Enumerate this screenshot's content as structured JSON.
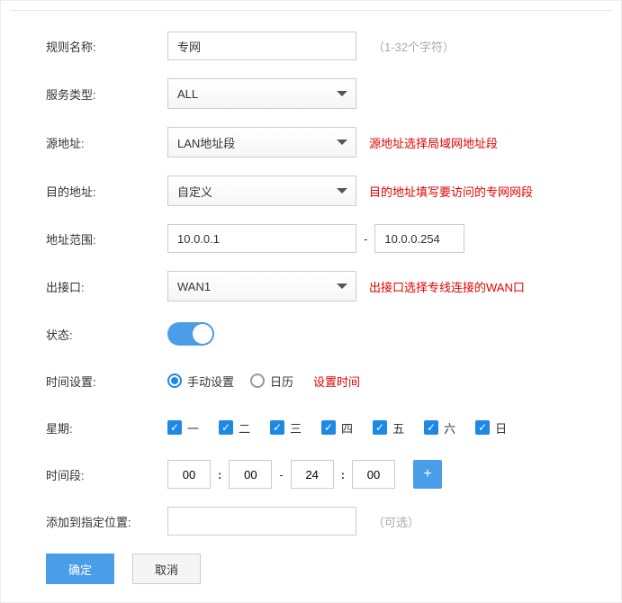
{
  "labels": {
    "rule_name": "规则名称:",
    "service_type": "服务类型:",
    "src_addr": "源地址:",
    "dst_addr": "目的地址:",
    "addr_range": "地址范围:",
    "out_if": "出接口:",
    "status": "状态:",
    "time_set": "时间设置:",
    "week": "星期:",
    "time_range": "时间段:",
    "add_to_pos": "添加到指定位置:"
  },
  "values": {
    "rule_name": "专网",
    "service_type": "ALL",
    "src_addr": "LAN地址段",
    "dst_addr": "自定义",
    "addr_start": "10.0.0.1",
    "addr_end": "10.0.0.254",
    "out_if": "WAN1",
    "time_h1": "00",
    "time_m1": "00",
    "time_h2": "24",
    "time_m2": "00",
    "add_pos": ""
  },
  "hints": {
    "rule_name": "（1-32个字符）",
    "src_addr": "源地址选择局域网地址段",
    "dst_addr": "目的地址填写要访问的专网网段",
    "out_if": "出接口选择专线连接的WAN口",
    "time_set": "设置时间",
    "add_pos": "（可选）"
  },
  "radio": {
    "manual": "手动设置",
    "calendar": "日历"
  },
  "weekdays": [
    "一",
    "二",
    "三",
    "四",
    "五",
    "六",
    "日"
  ],
  "buttons": {
    "ok": "确定",
    "cancel": "取消",
    "add": "+"
  }
}
